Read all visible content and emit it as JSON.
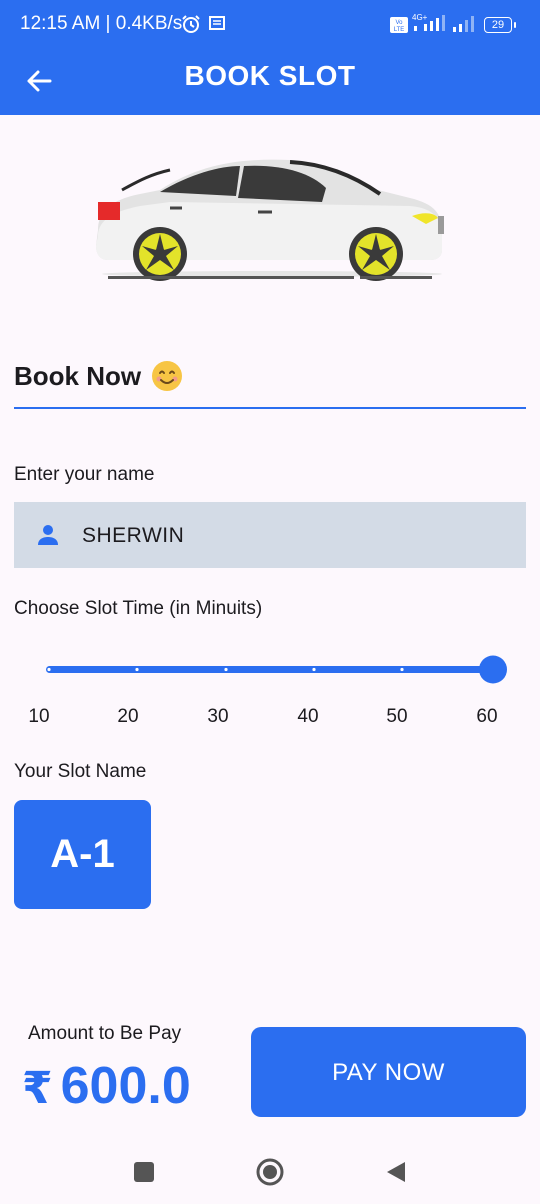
{
  "status_bar": {
    "time": "12:15 AM | 0.4KB/s",
    "network_label": "4G+",
    "volte_label": "Vo LTE",
    "battery": "29",
    "icons": [
      "alarm-icon",
      "message-icon",
      "signal-icon",
      "battery-icon"
    ]
  },
  "app_bar": {
    "title": "BOOK SLOT",
    "back_icon": "arrow-back-icon",
    "color": "#2b6ef0"
  },
  "form": {
    "heading": "Book Now",
    "heading_emoji": "😊",
    "name_label": "Enter your name",
    "name_value": "SHERWIN",
    "slot_time_label": "Choose Slot Time (in Minuits)",
    "slider": {
      "min": 10,
      "max": 60,
      "value": 60,
      "ticks": [
        "10",
        "20",
        "30",
        "40",
        "50",
        "60"
      ]
    },
    "slot_name_label": "Your Slot Name",
    "slot_name": "A-1"
  },
  "payment": {
    "amount_label": "Amount to Be Pay",
    "currency_symbol": "₹",
    "amount": "600.0",
    "pay_button": "PAY NOW"
  },
  "nav_bar": {
    "buttons": [
      "recents-button",
      "home-button",
      "back-button"
    ]
  }
}
